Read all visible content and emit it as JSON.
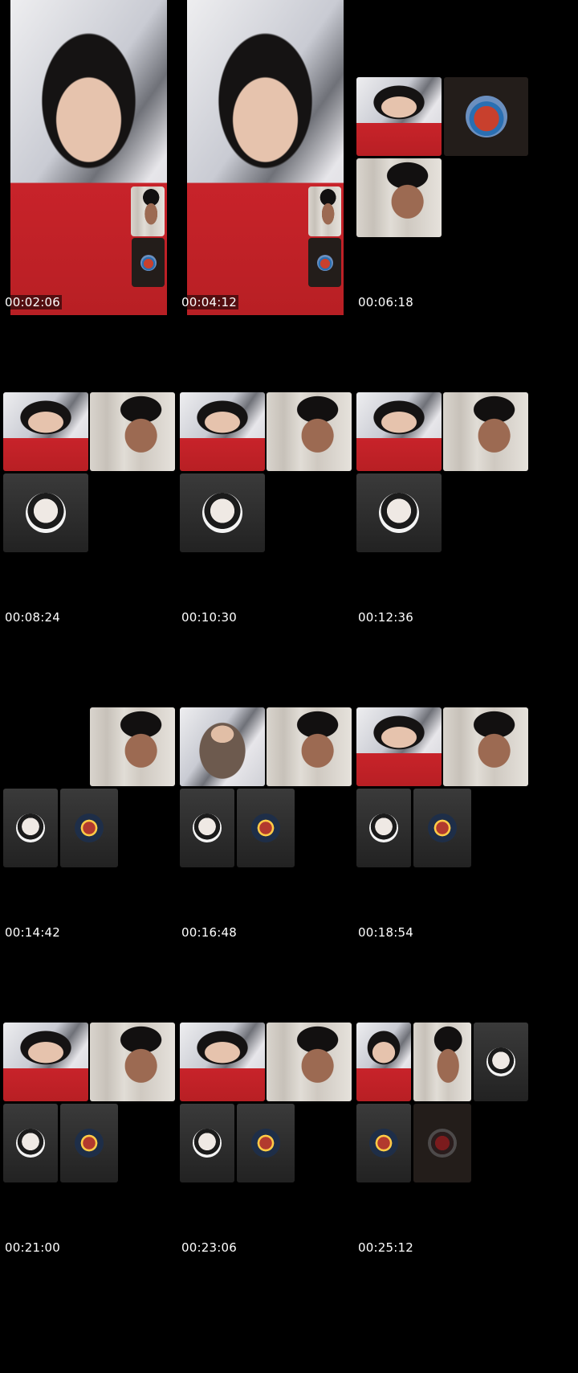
{
  "timestamps": [
    "00:02:06",
    "00:04:12",
    "00:06:18",
    "00:08:24",
    "00:10:30",
    "00:12:36",
    "00:14:42",
    "00:16:48",
    "00:18:54",
    "00:21:00",
    "00:23:06",
    "00:25:12"
  ],
  "icons": {
    "cap-avatar": "cap-avatar-icon",
    "hero-avatar": "hero-avatar-icon",
    "crab-avatar": "crab-avatar-icon",
    "car-avatar": "car-avatar-icon"
  },
  "colors": {
    "background": "#000000",
    "timestamp_text": "#ffffff",
    "dress_red": "#c8232a"
  }
}
